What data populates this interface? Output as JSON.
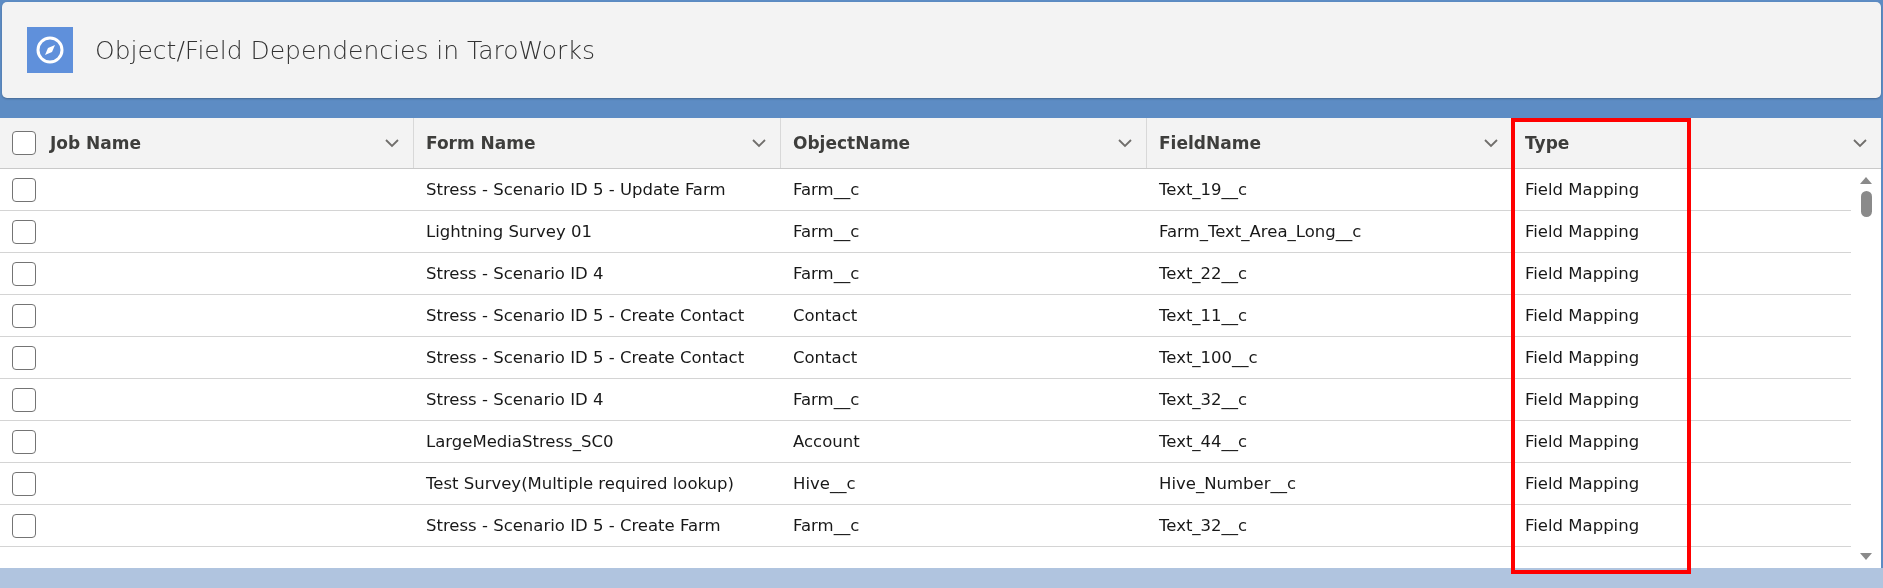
{
  "header": {
    "title": "Object/Field Dependencies in TaroWorks"
  },
  "table": {
    "select_all": {
      "checked": false
    },
    "columns": [
      {
        "label": "Job Name",
        "highlighted": false
      },
      {
        "label": "Form Name",
        "highlighted": false
      },
      {
        "label": "ObjectName",
        "highlighted": false
      },
      {
        "label": "FieldName",
        "highlighted": false
      },
      {
        "label": "Type",
        "highlighted": true
      }
    ],
    "rows": [
      {
        "checked": false,
        "form_name": "Stress - Scenario ID 5 - Update Farm",
        "object_name": "Farm__c",
        "field_name": "Text_19__c",
        "type": "Field Mapping"
      },
      {
        "checked": false,
        "form_name": "Lightning Survey 01",
        "object_name": "Farm__c",
        "field_name": "Farm_Text_Area_Long__c",
        "type": "Field Mapping"
      },
      {
        "checked": false,
        "form_name": "Stress - Scenario ID 4",
        "object_name": "Farm__c",
        "field_name": "Text_22__c",
        "type": "Field Mapping"
      },
      {
        "checked": false,
        "form_name": "Stress - Scenario ID 5 - Create Contact",
        "object_name": "Contact",
        "field_name": "Text_11__c",
        "type": "Field Mapping"
      },
      {
        "checked": false,
        "form_name": "Stress - Scenario ID 5 - Create Contact",
        "object_name": "Contact",
        "field_name": "Text_100__c",
        "type": "Field Mapping"
      },
      {
        "checked": false,
        "form_name": "Stress - Scenario ID 4",
        "object_name": "Farm__c",
        "field_name": "Text_32__c",
        "type": "Field Mapping"
      },
      {
        "checked": false,
        "form_name": "LargeMediaStress_SC0",
        "object_name": "Account",
        "field_name": "Text_44__c",
        "type": "Field Mapping"
      },
      {
        "checked": false,
        "form_name": "Test Survey(Multiple required lookup)",
        "object_name": "Hive__c",
        "field_name": "Hive_Number__c",
        "type": "Field Mapping"
      },
      {
        "checked": false,
        "form_name": "Stress - Scenario ID 5 - Create Farm",
        "object_name": "Farm__c",
        "field_name": "Text_32__c",
        "type": "Field Mapping"
      }
    ]
  }
}
